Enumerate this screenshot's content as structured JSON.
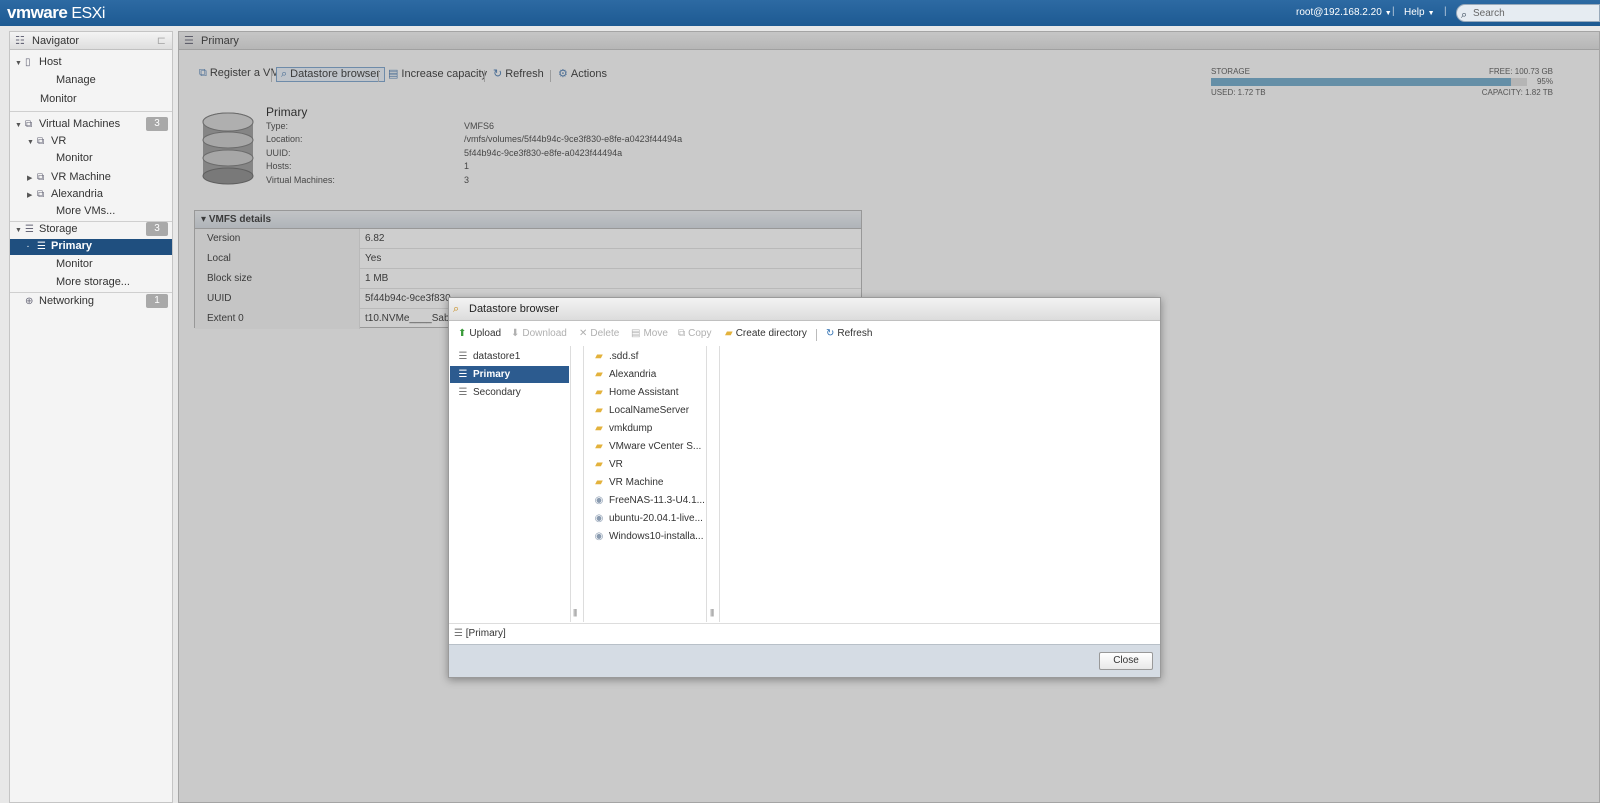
{
  "header": {
    "brand": "vmware",
    "product": "ESXi",
    "user": "root@192.168.2.20",
    "help": "Help",
    "search_placeholder": "Search"
  },
  "navigator": {
    "title": "Navigator",
    "host": "Host",
    "host_manage": "Manage",
    "host_monitor": "Monitor",
    "vms": "Virtual Machines",
    "vms_count": "3",
    "vm_vr": "VR",
    "vm_vr_monitor": "Monitor",
    "vm_vr_machine": "VR Machine",
    "vm_alexandria": "Alexandria",
    "more_vms": "More VMs...",
    "storage": "Storage",
    "storage_count": "3",
    "storage_primary": "Primary",
    "storage_monitor": "Monitor",
    "more_storage": "More storage...",
    "networking": "Networking",
    "networking_count": "1"
  },
  "main": {
    "title": "Primary",
    "toolbar": {
      "register_vm": "Register a VM",
      "datastore_browser": "Datastore browser",
      "increase_capacity": "Increase capacity",
      "refresh": "Refresh",
      "actions": "Actions"
    },
    "datastore": {
      "name": "Primary",
      "type_label": "Type:",
      "type_value": "VMFS6",
      "location_label": "Location:",
      "location_value": "/vmfs/volumes/5f44b94c-9ce3f830-e8fe-a0423f44494a",
      "uuid_label": "UUID:",
      "uuid_value": "5f44b94c-9ce3f830-e8fe-a0423f44494a",
      "hosts_label": "Hosts:",
      "hosts_value": "1",
      "vms_label": "Virtual Machines:",
      "vms_value": "3"
    },
    "storage": {
      "label": "STORAGE",
      "free": "FREE: 100.73 GB",
      "percent": "95%",
      "used_fraction": 0.95,
      "used": "USED: 1.72 TB",
      "capacity": "CAPACITY: 1.82 TB"
    },
    "vmfs": {
      "title": "VMFS details",
      "rows": [
        {
          "k": "Version",
          "v": "6.82"
        },
        {
          "k": "Local",
          "v": "Yes"
        },
        {
          "k": "Block size",
          "v": "1 MB"
        },
        {
          "k": "UUID",
          "v": "5f44b94c-9ce3f830"
        },
        {
          "k": "Extent 0",
          "v": "t10.NVMe____Sab"
        }
      ]
    }
  },
  "dialog": {
    "title": "Datastore browser",
    "toolbar": {
      "upload": "Upload",
      "download": "Download",
      "delete": "Delete",
      "move": "Move",
      "copy": "Copy",
      "create_directory": "Create directory",
      "refresh": "Refresh"
    },
    "datastores": [
      "datastore1",
      "Primary",
      "Secondary"
    ],
    "files": [
      {
        "name": ".sdd.sf",
        "kind": "folder"
      },
      {
        "name": "Alexandria",
        "kind": "folder"
      },
      {
        "name": "Home Assistant",
        "kind": "folder"
      },
      {
        "name": "LocalNameServer",
        "kind": "folder"
      },
      {
        "name": "vmkdump",
        "kind": "folder"
      },
      {
        "name": "VMware vCenter S...",
        "kind": "folder"
      },
      {
        "name": "VR",
        "kind": "folder"
      },
      {
        "name": "VR Machine",
        "kind": "folder"
      },
      {
        "name": "FreeNAS-11.3-U4.1...",
        "kind": "iso"
      },
      {
        "name": "ubuntu-20.04.1-live...",
        "kind": "iso"
      },
      {
        "name": "Windows10-installa...",
        "kind": "iso"
      }
    ],
    "path": "[Primary]",
    "close": "Close"
  }
}
